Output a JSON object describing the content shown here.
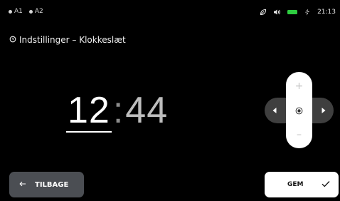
{
  "status_bar": {
    "sim_slots": [
      "A1",
      "A2"
    ],
    "time": "21:13",
    "battery_color": "#2ecc40",
    "icons": [
      "leaf-icon",
      "volume-icon",
      "battery-icon",
      "charging-bolt-icon"
    ]
  },
  "page": {
    "title": "Indstillinger – Klokkeslæt",
    "title_icon": "clock-icon"
  },
  "clock": {
    "hours": "12",
    "separator": ":",
    "minutes": "44",
    "active_field": "hours"
  },
  "dpad": {
    "up_label": "+",
    "down_label": "–",
    "left_icon": "triangle-left-icon",
    "right_icon": "triangle-right-icon",
    "center_icon": "radio-dot-icon"
  },
  "buttons": {
    "back": {
      "label": "TILBAGE",
      "icon": "arrow-left-icon"
    },
    "save": {
      "label": "GEM",
      "icon": "checkmark-icon"
    }
  },
  "colors": {
    "background": "#000000",
    "dpad_vertical": "#ffffff",
    "dpad_horizontal": "#3f3f3f",
    "back_button": "#4b4e53",
    "save_button": "#ffffff"
  }
}
